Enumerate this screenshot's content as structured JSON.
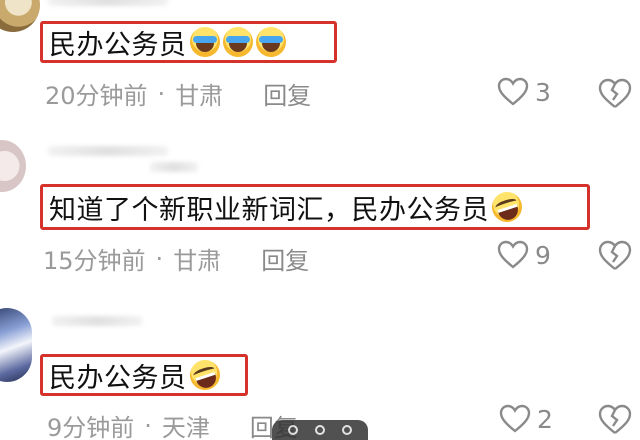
{
  "comments": [
    {
      "text": "民办公务员",
      "emojis": [
        "cry-laugh-emoji",
        "cry-laugh-emoji",
        "cry-laugh-emoji"
      ],
      "time": "20分钟前",
      "location": "甘肃",
      "reply": "回复",
      "likes": "3"
    },
    {
      "text": "知道了个新职业新词汇，民办公务员",
      "emojis": [
        "rofl-emoji"
      ],
      "time": "15分钟前",
      "location": "甘肃",
      "reply": "回复",
      "likes": "9"
    },
    {
      "text": "民办公务员",
      "emojis": [
        "rofl-emoji"
      ],
      "time": "9分钟前",
      "location": "天津",
      "reply": "回复",
      "likes": "2"
    }
  ],
  "separator": "·",
  "colors": {
    "highlight_border": "#d6322c",
    "meta_text": "#9a9a9a"
  }
}
